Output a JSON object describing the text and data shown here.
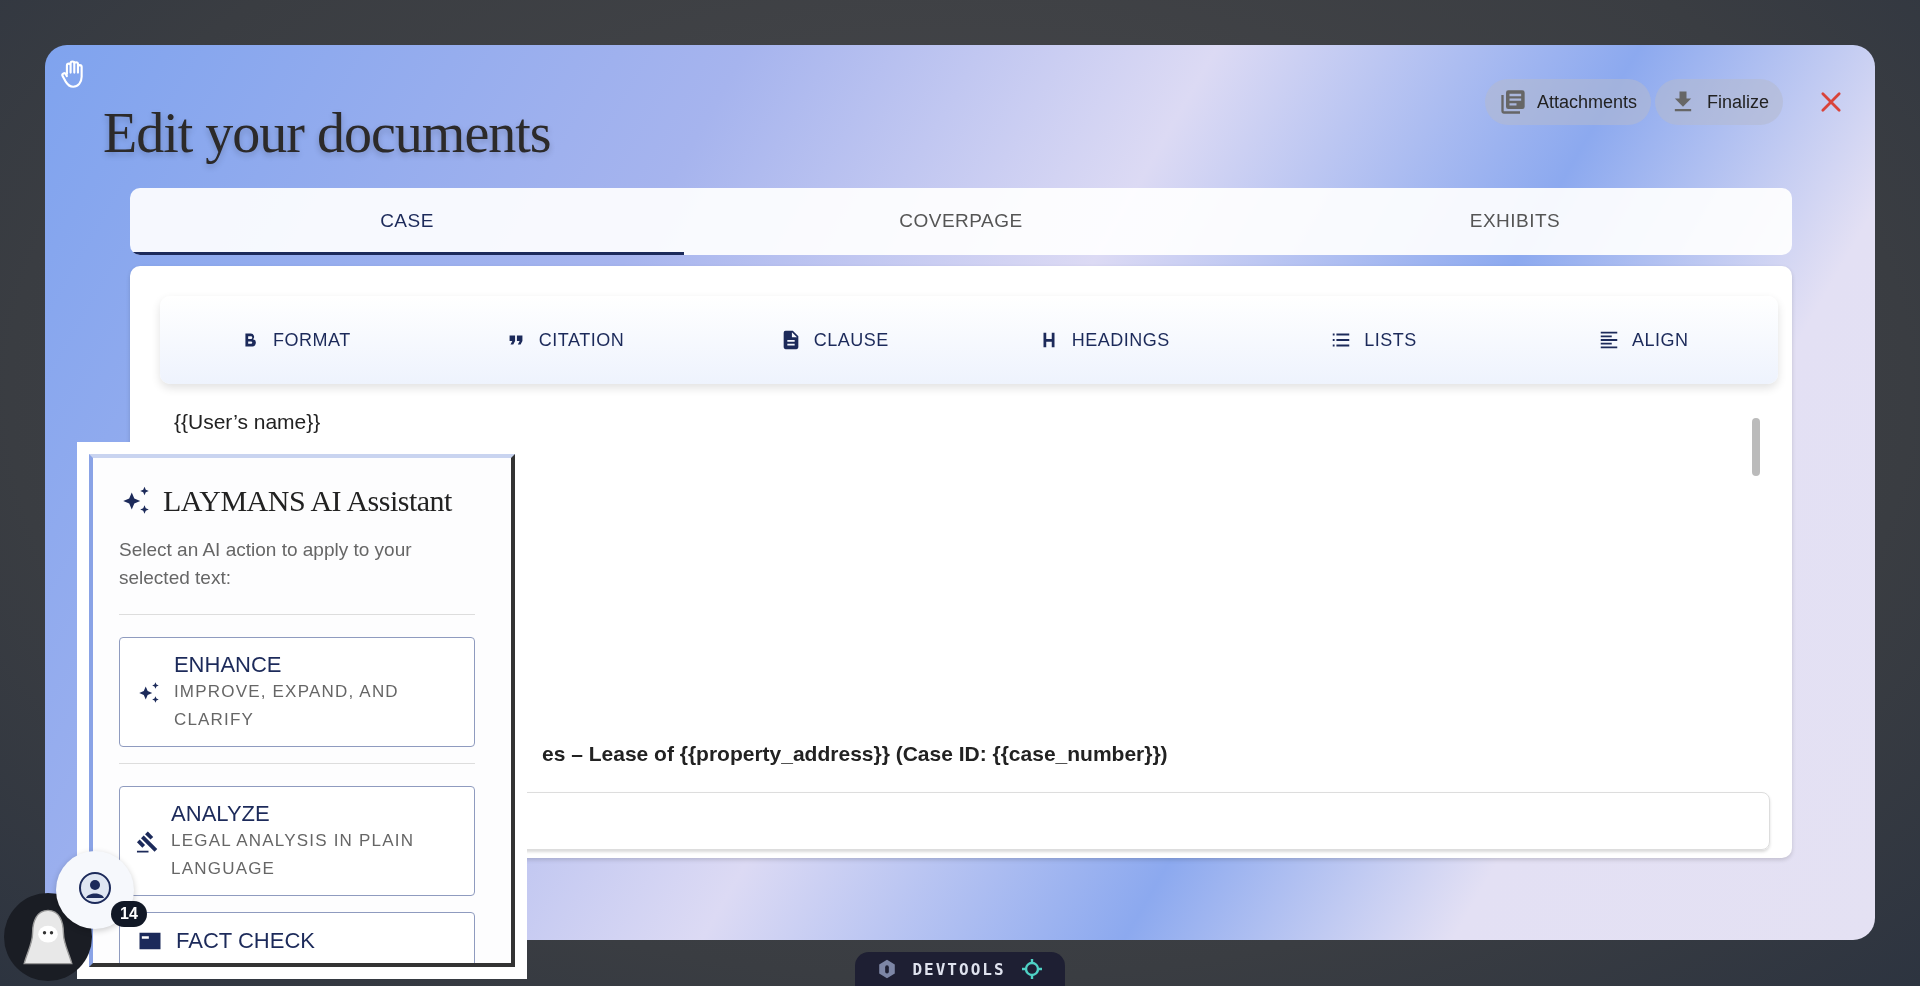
{
  "window": {
    "title": "Edit your documents"
  },
  "header_buttons": [
    {
      "kind": "attachments",
      "label": "Attachments"
    },
    {
      "kind": "finalize",
      "label": "Finalize"
    }
  ],
  "tabs": [
    {
      "label": "CASE",
      "selected": true
    },
    {
      "label": "COVERPAGE",
      "selected": false
    },
    {
      "label": "EXHIBITS",
      "selected": false
    }
  ],
  "toolbar": [
    {
      "kind": "format",
      "label": "FORMAT"
    },
    {
      "kind": "citation",
      "label": "CITATION"
    },
    {
      "kind": "clause",
      "label": "CLAUSE"
    },
    {
      "kind": "headings",
      "label": "HEADINGS"
    },
    {
      "kind": "lists",
      "label": "LISTS"
    },
    {
      "kind": "align",
      "label": "ALIGN"
    }
  ],
  "editor": {
    "lines": [
      {
        "kind": "text",
        "text": "{{User’s name}}"
      },
      {
        "kind": "heading",
        "text": "es – Lease of {{property_address}} (Case ID: {{case_number}})"
      }
    ]
  },
  "assistant": {
    "title": "LAYMANS AI Assistant",
    "description": "Select an AI action to apply to your selected text:",
    "actions": [
      {
        "kind": "enhance",
        "label": "ENHANCE",
        "description": "IMPROVE, EXPAND, AND CLARIFY"
      },
      {
        "kind": "analyze",
        "label": "ANALYZE",
        "description": "LEGAL ANALYSIS IN PLAIN LANGUAGE"
      },
      {
        "kind": "fact_check",
        "label": "FACT CHECK"
      }
    ]
  },
  "notification_badge": "14",
  "devtools": {
    "label": "DEVTOOLS"
  }
}
